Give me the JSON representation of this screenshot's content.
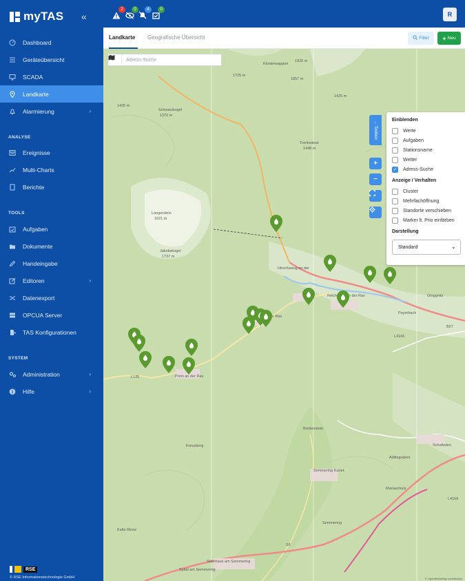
{
  "brand": {
    "title": "myTAS",
    "collapse_icon": "double-chevron-left-icon"
  },
  "sidebar": {
    "items": [
      {
        "label": "Dashboard",
        "icon": "dashboard-icon"
      },
      {
        "label": "Geräteübersicht",
        "icon": "list-icon"
      },
      {
        "label": "SCADA",
        "icon": "monitor-icon"
      },
      {
        "label": "Landkarte",
        "icon": "map-pin-icon",
        "active": true
      },
      {
        "label": "Alarmierung",
        "icon": "bell-icon",
        "has_submenu": true
      }
    ],
    "sections": [
      {
        "label": "ANALYSE",
        "items": [
          {
            "label": "Ereignisse",
            "icon": "events-icon"
          },
          {
            "label": "Multi-Charts",
            "icon": "line-chart-icon"
          },
          {
            "label": "Berichte",
            "icon": "report-icon"
          }
        ]
      },
      {
        "label": "TOOLS",
        "items": [
          {
            "label": "Aufgaben",
            "icon": "calendar-check-icon"
          },
          {
            "label": "Dokumente",
            "icon": "folder-icon"
          },
          {
            "label": "Handeingabe",
            "icon": "pencil-icon"
          },
          {
            "label": "Editoren",
            "icon": "edit-icon",
            "has_submenu": true
          },
          {
            "label": "Datenexport",
            "icon": "shuffle-icon"
          },
          {
            "label": "OPCUA Server",
            "icon": "server-icon"
          },
          {
            "label": "TAS Konfigurationen",
            "icon": "file-export-icon"
          }
        ]
      },
      {
        "label": "SYSTEM",
        "items": [
          {
            "label": "Administration",
            "icon": "cogs-icon",
            "has_submenu": true
          },
          {
            "label": "Hilfe",
            "icon": "info-icon",
            "has_submenu": true
          }
        ]
      }
    ],
    "footer": {
      "logo_text": "RSE",
      "copyright": "© RSE Informationstechnologie GmbH"
    }
  },
  "topbar": {
    "alerts": [
      {
        "icon": "warning-icon",
        "count": "2",
        "color": "#e53935"
      },
      {
        "icon": "eye-slash-icon",
        "count": "0",
        "color": "#43a047"
      },
      {
        "icon": "bell-slash-icon",
        "count": "4",
        "color": "#3f8ee8"
      },
      {
        "icon": "task-check-icon",
        "count": "0",
        "color": "#43a047"
      }
    ],
    "avatar_initial": "R"
  },
  "tabs": [
    {
      "label": "Landkarte",
      "active": true
    },
    {
      "label": "Geografische Übersicht",
      "active": false
    }
  ],
  "actions": {
    "filter_label": "Filter",
    "new_label": "Neu"
  },
  "map": {
    "search_placeholder": "Adress-Suche",
    "toolbox_label": "Toolbox",
    "controls": {
      "zoom_in": "+",
      "zoom_out": "−"
    },
    "labels": [
      "Klosterwappen",
      "1925 m",
      "1857 m",
      "1425 m",
      "1725 m",
      "1425 m",
      "Schwarzkogel",
      "1370 m",
      "Trenkwiese",
      "1448 m",
      "Langerstein",
      "1621 m",
      "Jakobskogel",
      "1737 m",
      "Hirschwang an der",
      "Reichenau an der Rax",
      "Payerbach",
      "Edlach an der Rax",
      "Prein an der Rax",
      "L135",
      "B27",
      "L4166",
      "Breitenstein",
      "Semmering Kurort",
      "Semmering",
      "Schottwien",
      "Steinhaus am Semmering",
      "Spital am Semmering",
      "S6",
      "L4168",
      "Adlitzgraben",
      "Kalte Rinne",
      "Gloggnitz",
      "Mariaschutz",
      "Kreuzberg"
    ],
    "attribution": "© OpenStreetMap contributors"
  },
  "toolbox": {
    "einblenden": {
      "heading": "Einblenden",
      "items": [
        {
          "label": "Werte",
          "checked": false
        },
        {
          "label": "Aufgaben",
          "checked": false
        },
        {
          "label": "Stationsname",
          "checked": false
        },
        {
          "label": "Wetter",
          "checked": false
        },
        {
          "label": "Adress-Suche",
          "checked": true
        }
      ]
    },
    "verhalten": {
      "heading": "Anzeige / Verhalten",
      "items": [
        {
          "label": "Cluster",
          "checked": false
        },
        {
          "label": "Mehrfachöffnung",
          "checked": false
        },
        {
          "label": "Standorte verschieben",
          "checked": false
        },
        {
          "label": "Marker lt. Prio einfärben",
          "checked": false
        }
      ]
    },
    "darstellung": {
      "heading": "Darstellung",
      "value": "Standard"
    }
  },
  "colors": {
    "primary": "#0d4ea6",
    "accent": "#3f8ee8",
    "success": "#1fa24a",
    "marker": "#5a9a2e"
  }
}
